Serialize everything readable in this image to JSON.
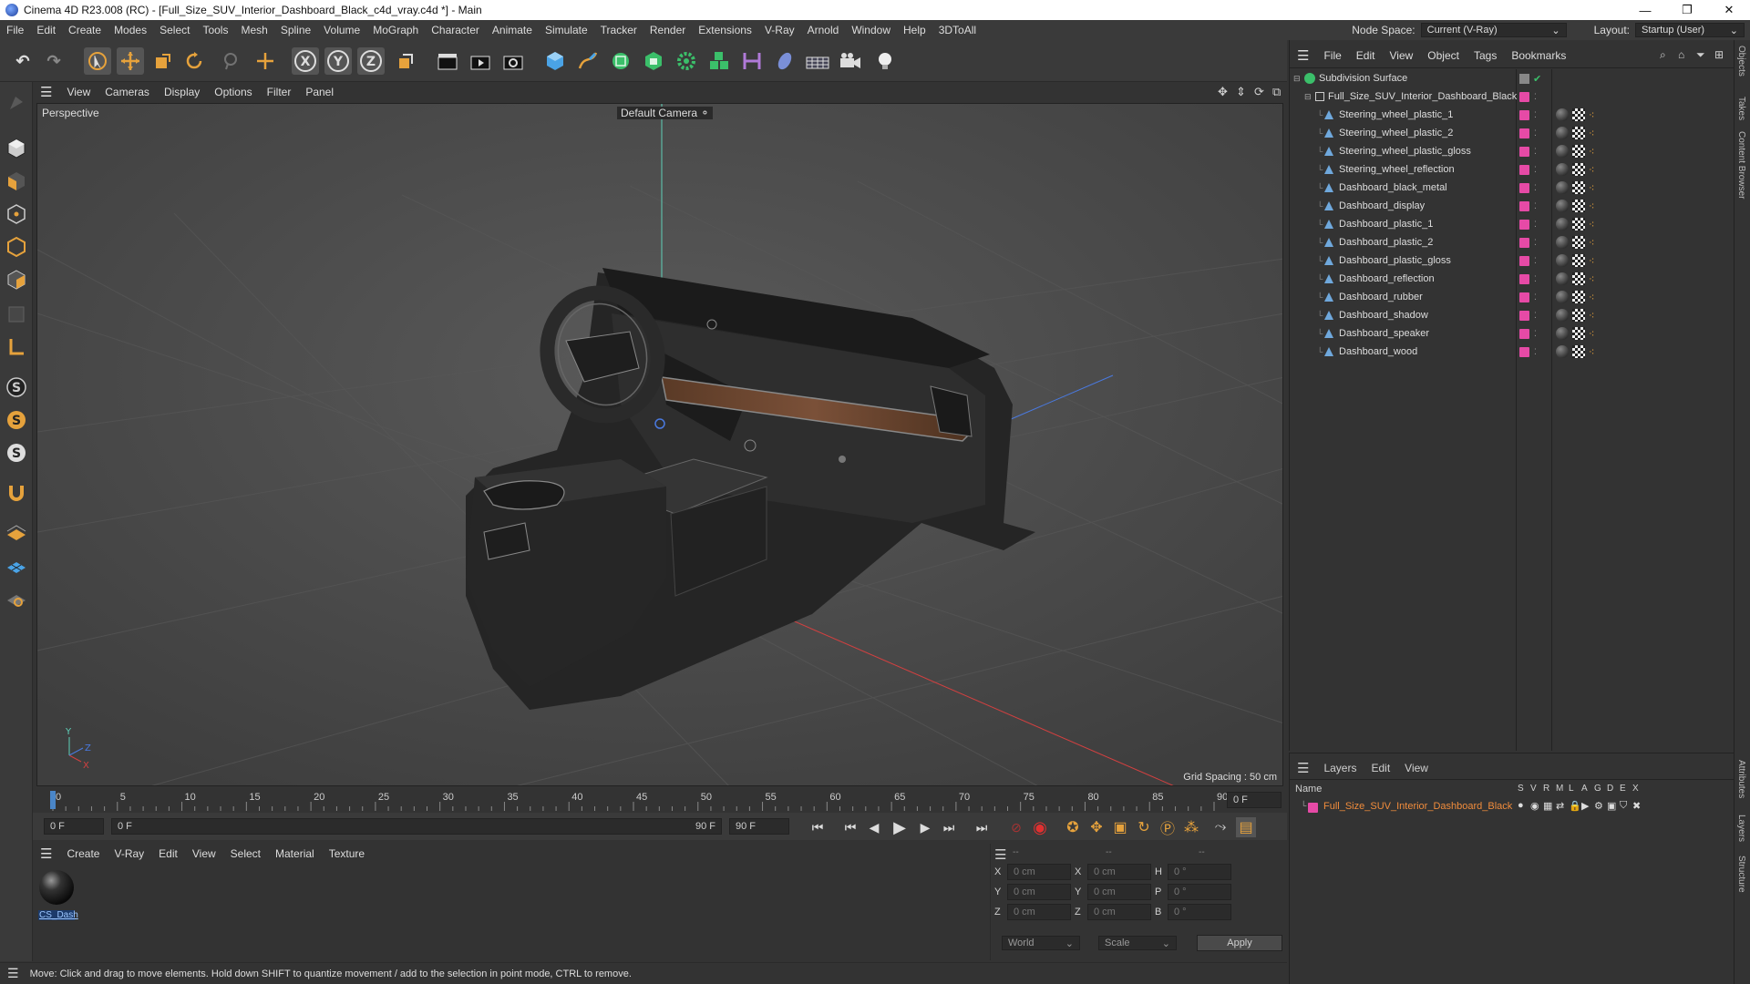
{
  "window": {
    "title": "Cinema 4D R23.008 (RC) - [Full_Size_SUV_Interior_Dashboard_Black_c4d_vray.c4d *] - Main",
    "minimize": "—",
    "maximize": "❐",
    "close": "✕"
  },
  "menu": [
    "File",
    "Edit",
    "Create",
    "Modes",
    "Select",
    "Tools",
    "Mesh",
    "Spline",
    "Volume",
    "MoGraph",
    "Character",
    "Animate",
    "Simulate",
    "Tracker",
    "Render",
    "Extensions",
    "V-Ray",
    "Arnold",
    "Window",
    "Help",
    "3DToAll"
  ],
  "header": {
    "node_space_label": "Node Space:",
    "node_space_value": "Current (V-Ray)",
    "layout_label": "Layout:",
    "layout_value": "Startup (User)"
  },
  "toolbar": {
    "undo": "↶",
    "redo": "↷",
    "x": "X",
    "y": "Y",
    "z": "Z"
  },
  "viewport_menu": [
    "View",
    "Cameras",
    "Display",
    "Options",
    "Filter",
    "Panel"
  ],
  "viewport": {
    "label": "Perspective",
    "camera": "Default Camera",
    "grid_spacing": "Grid Spacing : 50 cm",
    "axis_x": "X",
    "axis_y": "Y",
    "axis_z": "Z"
  },
  "timeline": {
    "ticks": [
      "0",
      "5",
      "10",
      "15",
      "20",
      "25",
      "30",
      "35",
      "40",
      "45",
      "50",
      "55",
      "60",
      "65",
      "70",
      "75",
      "80",
      "85",
      "90"
    ],
    "current_frame": "0 F"
  },
  "transport": {
    "start_field": "0 F",
    "range_start": "0 F",
    "range_end": "90 F",
    "end_field": "90 F"
  },
  "material_menu": [
    "Create",
    "V-Ray",
    "Edit",
    "View",
    "Select",
    "Material",
    "Texture"
  ],
  "materials": [
    {
      "name": "CS_Dash"
    }
  ],
  "coords": {
    "headers": [
      "--",
      "--",
      "--"
    ],
    "rows": [
      {
        "a": "X",
        "av": "0 cm",
        "b": "X",
        "bv": "0 cm",
        "c": "H",
        "cv": "0 °"
      },
      {
        "a": "Y",
        "av": "0 cm",
        "b": "Y",
        "bv": "0 cm",
        "c": "P",
        "cv": "0 °"
      },
      {
        "a": "Z",
        "av": "0 cm",
        "b": "Z",
        "bv": "0 cm",
        "c": "B",
        "cv": "0 °"
      }
    ],
    "world": "World",
    "scale": "Scale",
    "apply": "Apply"
  },
  "status": "Move: Click and drag to move elements. Hold down SHIFT to quantize movement / add to the selection in point mode, CTRL to remove.",
  "object_menu": [
    "File",
    "Edit",
    "View",
    "Object",
    "Tags",
    "Bookmarks"
  ],
  "objects": {
    "root": "Subdivision Surface",
    "group": "Full_Size_SUV_Interior_Dashboard_Black",
    "children": [
      "Steering_wheel_plastic_1",
      "Steering_wheel_plastic_2",
      "Steering_wheel_plastic_gloss",
      "Steering_wheel_reflection",
      "Dashboard_black_metal",
      "Dashboard_display",
      "Dashboard_plastic_1",
      "Dashboard_plastic_2",
      "Dashboard_plastic_gloss",
      "Dashboard_reflection",
      "Dashboard_rubber",
      "Dashboard_shadow",
      "Dashboard_speaker",
      "Dashboard_wood"
    ]
  },
  "layers": {
    "menu": [
      "Layers",
      "Edit",
      "View"
    ],
    "name_header": "Name",
    "columns": [
      "S",
      "V",
      "R",
      "M",
      "L",
      "A",
      "G",
      "D",
      "E",
      "X"
    ],
    "items": [
      "Full_Size_SUV_Interior_Dashboard_Black"
    ]
  },
  "side_tabs": [
    "Objects",
    "Takes",
    "Content Browser",
    "Attributes",
    "Layers",
    "Structure"
  ],
  "colors": {
    "accent": "#e64aa6",
    "layer_text": "#f08c3c"
  }
}
